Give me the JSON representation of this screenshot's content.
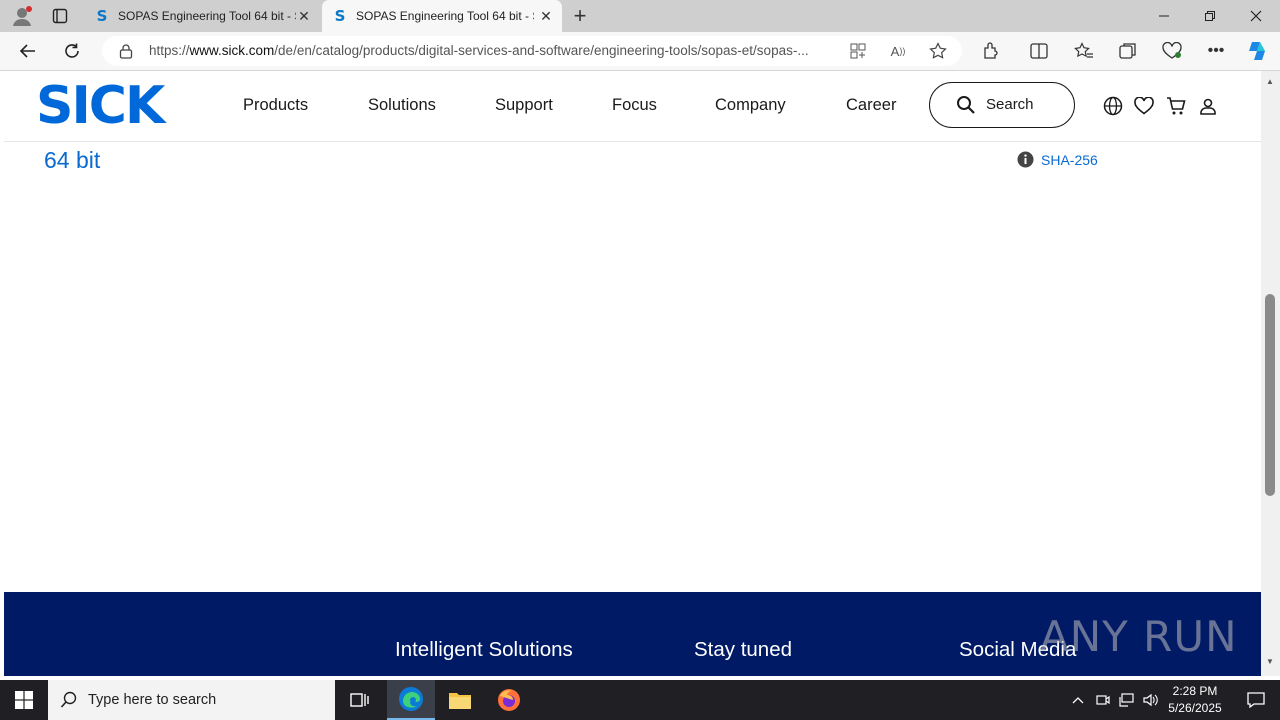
{
  "browser": {
    "tabs": [
      {
        "title": "SOPAS Engineering Tool 64 bit - S",
        "favicon": "S",
        "active": false
      },
      {
        "title": "SOPAS Engineering Tool 64 bit - S",
        "favicon": "S",
        "active": true
      }
    ],
    "url_prefix": "https://",
    "url_host": "www.sick.com",
    "url_path": "/de/en/catalog/products/digital-services-and-software/engineering-tools/sopas-et/sopas-..."
  },
  "site": {
    "logo": "SICK",
    "nav": [
      "Products",
      "Solutions",
      "Support",
      "Focus",
      "Company",
      "Career"
    ],
    "search_label": "Search",
    "brand_color": "#0068d9"
  },
  "content": {
    "title_fragment": "64 bit",
    "sha_label": "SHA-256"
  },
  "footer": {
    "headings": [
      "Intelligent Solutions",
      "Stay tuned",
      "Social Media"
    ],
    "bg_color": "#001a66"
  },
  "watermark": "ANY RUN",
  "taskbar": {
    "search_placeholder": "Type here to search",
    "time": "2:28 PM",
    "date": "5/26/2025"
  }
}
